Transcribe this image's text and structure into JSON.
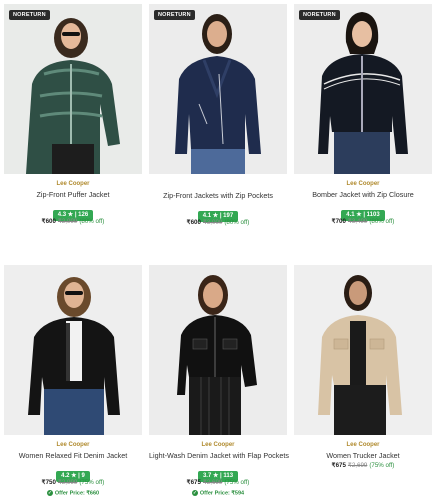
{
  "products": [
    {
      "badge": "NORETURN",
      "brand": "Lee Cooper",
      "name": "Zip-Front Puffer Jacket",
      "rating": "4.3 ★ | 126",
      "price": "₹600",
      "mrp": "₹2,999",
      "discount": "(80% off)",
      "image_bg": "#e9ebe9",
      "garment_color": "#2f4f45",
      "image": "woman-green-puffer-jacket"
    },
    {
      "badge": "NORETURN",
      "brand": "",
      "name": "Zip-Front Jackets with Zip Pockets",
      "rating": "4.1 ★ | 197",
      "price": "₹600",
      "mrp": "₹3,000",
      "discount": "(80% off)",
      "image_bg": "#ececec",
      "garment_color": "#1f2c4d",
      "image": "woman-navy-biker-jacket"
    },
    {
      "badge": "NORETURN",
      "brand": "Lee Cooper",
      "name": "Bomber Jacket with Zip Closure",
      "rating": "4.1 ★ | 1103",
      "price": "₹700",
      "mrp": "₹3,499",
      "discount": "(80% off)",
      "image_bg": "#ededed",
      "garment_color": "#141923",
      "image": "woman-black-bomber-jacket"
    },
    {
      "badge": "",
      "brand": "Lee Cooper",
      "name": "Women Relaxed Fit Denim Jacket",
      "rating": "4.2 ★ | 9",
      "price": "₹750",
      "mrp": "₹2,999",
      "discount": "(75% off)",
      "offer": "Offer Price: ₹660",
      "image_bg": "#eeeeee",
      "garment_color": "#141414",
      "image": "woman-black-denim-jacket"
    },
    {
      "badge": "",
      "brand": "Lee Cooper",
      "name": "Light-Wash Denim Jacket with Flap Pockets",
      "rating": "3.7 ★ | 113",
      "price": "₹675",
      "mrp": "₹2,699",
      "discount": "(75% off)",
      "offer": "Offer Price: ₹594",
      "image_bg": "#ececec",
      "garment_color": "#111111",
      "image": "woman-black-denim-flap-jacket"
    },
    {
      "badge": "",
      "brand": "Lee Cooper",
      "name": "Women Trucker Jacket",
      "rating": "",
      "price": "₹675",
      "mrp": "₹2,699",
      "discount": "(75% off)",
      "image_bg": "#efefef",
      "garment_color": "#d8c3a5",
      "image": "woman-beige-trucker-jacket"
    }
  ]
}
